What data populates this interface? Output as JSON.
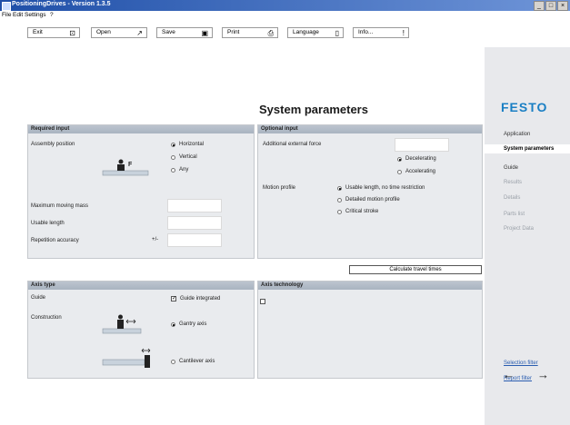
{
  "window": {
    "title": "PositioningDrives - Version 1.3.5",
    "controls": [
      "_",
      "□",
      "×"
    ]
  },
  "menu": [
    "File",
    "Edit",
    "Settings",
    "?"
  ],
  "toolbar": [
    {
      "label": "Exit",
      "icon": "exit-icon",
      "glyph": "⊡"
    },
    {
      "label": "Open",
      "icon": "open-icon",
      "glyph": "↗"
    },
    {
      "label": "Save",
      "icon": "save-icon",
      "glyph": "▣"
    },
    {
      "label": "Print",
      "icon": "print-icon",
      "glyph": "⎙"
    },
    {
      "label": "Language",
      "icon": "language-icon",
      "glyph": "▯"
    },
    {
      "label": "Info...",
      "icon": "info-icon",
      "glyph": "ǃ"
    }
  ],
  "page_title": "System parameters",
  "brand": {
    "logo": "FESTO",
    "color": "#1a7fc4"
  },
  "sidebar": {
    "items": [
      {
        "label": "Application",
        "state": "enabled"
      },
      {
        "label": "System parameters",
        "state": "selected"
      },
      {
        "label": "Guide",
        "state": "enabled"
      },
      {
        "label": "Results",
        "state": "disabled"
      },
      {
        "label": "Details",
        "state": "disabled"
      },
      {
        "label": "Parts list",
        "state": "disabled"
      },
      {
        "label": "Project Data",
        "state": "disabled"
      }
    ],
    "links": [
      "Selection filter",
      "Report filter"
    ],
    "nav": {
      "back": "←",
      "forward": "→"
    }
  },
  "required_input": {
    "header": "Required input",
    "assembly_position_label": "Assembly position",
    "positions": [
      {
        "label": "Horizontal",
        "selected": true
      },
      {
        "label": "Vertical",
        "selected": false
      },
      {
        "label": "Any",
        "selected": false
      }
    ],
    "force_label": "F",
    "max_mass_label": "Maximum moving mass",
    "usable_length_label": "Usable length",
    "repetition_accuracy_label": "Repetition accuracy",
    "plus_minus": "+/-"
  },
  "optional_input": {
    "header": "Optional input",
    "external_force_label": "Additional external force",
    "force_direction": [
      {
        "label": "Decelerating",
        "selected": true
      },
      {
        "label": "Accelerating",
        "selected": false
      }
    ],
    "motion_profile_label": "Motion profile",
    "motion_profiles": [
      {
        "label": "Usable length, no time restriction",
        "selected": true
      },
      {
        "label": "Detailed motion profile",
        "selected": false
      },
      {
        "label": "Critical stroke",
        "selected": false
      }
    ]
  },
  "calculate_button": "Calculate travel times",
  "axis_type": {
    "header": "Axis type",
    "guide_label": "Guide",
    "guide_integrated": {
      "label": "Guide integrated",
      "checked": true
    },
    "construction_label": "Construction",
    "constructions": [
      {
        "label": "Gantry axis",
        "selected": true
      },
      {
        "label": "Cantilever axis",
        "selected": false
      }
    ]
  },
  "axis_technology": {
    "header": "Axis technology"
  }
}
